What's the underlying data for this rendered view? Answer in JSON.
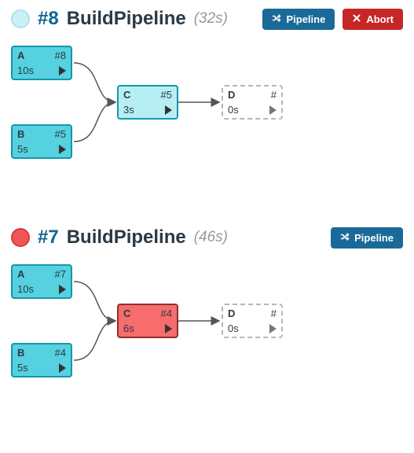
{
  "builds": [
    {
      "status": "running",
      "run_label": "#8",
      "name": "BuildPipeline",
      "elapsed": "(32s)",
      "pipeline_btn": "Pipeline",
      "abort_btn": "Abort",
      "has_abort": true,
      "nodes": {
        "A": {
          "name": "A",
          "run": "#8",
          "dur": "10s",
          "state": "solid"
        },
        "B": {
          "name": "B",
          "run": "#5",
          "dur": "5s",
          "state": "solid"
        },
        "C": {
          "name": "C",
          "run": "#5",
          "dur": "3s",
          "state": "running"
        },
        "D": {
          "name": "D",
          "run": "#",
          "dur": "0s",
          "state": "pending"
        }
      }
    },
    {
      "status": "fail",
      "run_label": "#7",
      "name": "BuildPipeline",
      "elapsed": "(46s)",
      "pipeline_btn": "Pipeline",
      "has_abort": false,
      "nodes": {
        "A": {
          "name": "A",
          "run": "#7",
          "dur": "10s",
          "state": "solid"
        },
        "B": {
          "name": "B",
          "run": "#4",
          "dur": "5s",
          "state": "solid"
        },
        "C": {
          "name": "C",
          "run": "#4",
          "dur": "6s",
          "state": "fail"
        },
        "D": {
          "name": "D",
          "run": "#",
          "dur": "0s",
          "state": "pending"
        }
      }
    }
  ]
}
